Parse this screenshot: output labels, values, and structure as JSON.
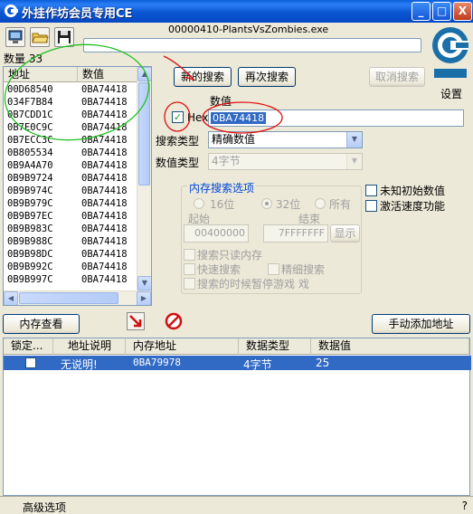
{
  "window": {
    "title": "外挂作坊会员专用CE",
    "process": "00000410-PlantsVsZombies.exe",
    "controls": {
      "minimize": "_",
      "maximize": "□",
      "close": "X"
    }
  },
  "toolbar": {
    "icons": [
      "computer-icon",
      "open-folder-icon",
      "save-disk-icon"
    ]
  },
  "logo": {
    "label": "设置"
  },
  "found": {
    "count_label": "数量 33",
    "headers": [
      "地址",
      "数值"
    ],
    "rows": [
      [
        "00D68540",
        "0BA74418"
      ],
      [
        "034F7B84",
        "0BA74418"
      ],
      [
        "0B7CDD1C",
        "0BA74418"
      ],
      [
        "0B7E0C9C",
        "0BA74418"
      ],
      [
        "0B7ECC3C",
        "0BA74418"
      ],
      [
        "0B805534",
        "0BA74418"
      ],
      [
        "0B9A4A70",
        "0BA74418"
      ],
      [
        "0B9B9724",
        "0BA74418"
      ],
      [
        "0B9B974C",
        "0BA74418"
      ],
      [
        "0B9B979C",
        "0BA74418"
      ],
      [
        "0B9B97EC",
        "0BA74418"
      ],
      [
        "0B9B983C",
        "0BA74418"
      ],
      [
        "0B9B988C",
        "0BA74418"
      ],
      [
        "0B9B98DC",
        "0BA74418"
      ],
      [
        "0B9B992C",
        "0BA74418"
      ],
      [
        "0B9B997C",
        "0BA74418"
      ]
    ]
  },
  "scan": {
    "new_scan": "新的搜索",
    "next_scan": "再次搜索",
    "cancel_scan": "取消搜索",
    "value_label": "数值",
    "hex_label": "Hex",
    "hex_checked": "✓",
    "value": "0BA74418",
    "scan_type_label": "搜索类型",
    "scan_type": "精确数值",
    "value_type_label": "数值类型",
    "value_type": "4字节"
  },
  "memory_options": {
    "title": "内存搜索选项",
    "bit16": "16位",
    "bit32": "32位",
    "all": "所有",
    "start_label": "起始",
    "end_label": "结束",
    "start": "00400000",
    "end": "7FFFFFFF",
    "show": "显示",
    "readonly": "搜索只读内存",
    "fast": "快速搜索",
    "fine": "精细搜索",
    "pause": "搜索的时候暂停游戏 戏"
  },
  "extra_options": {
    "unknown_initial": "未知初始数值",
    "speedhack": "激活速度功能"
  },
  "bottom": {
    "memory_view": "内存查看",
    "add_manual": "手动添加地址"
  },
  "address_table": {
    "headers": [
      "锁定...",
      "地址说明",
      "内存地址",
      "数据类型",
      "数据值"
    ],
    "rows": [
      {
        "description": "无说明!",
        "address": "0BA79978",
        "type": "4字节",
        "value": "25"
      }
    ]
  },
  "footer": {
    "advanced": "高级选项",
    "help": "?"
  },
  "colors": {
    "title_bar": "#0a57d2",
    "selection": "#316ac5",
    "annotation_red": "#e01010",
    "annotation_green": "#22c022"
  }
}
